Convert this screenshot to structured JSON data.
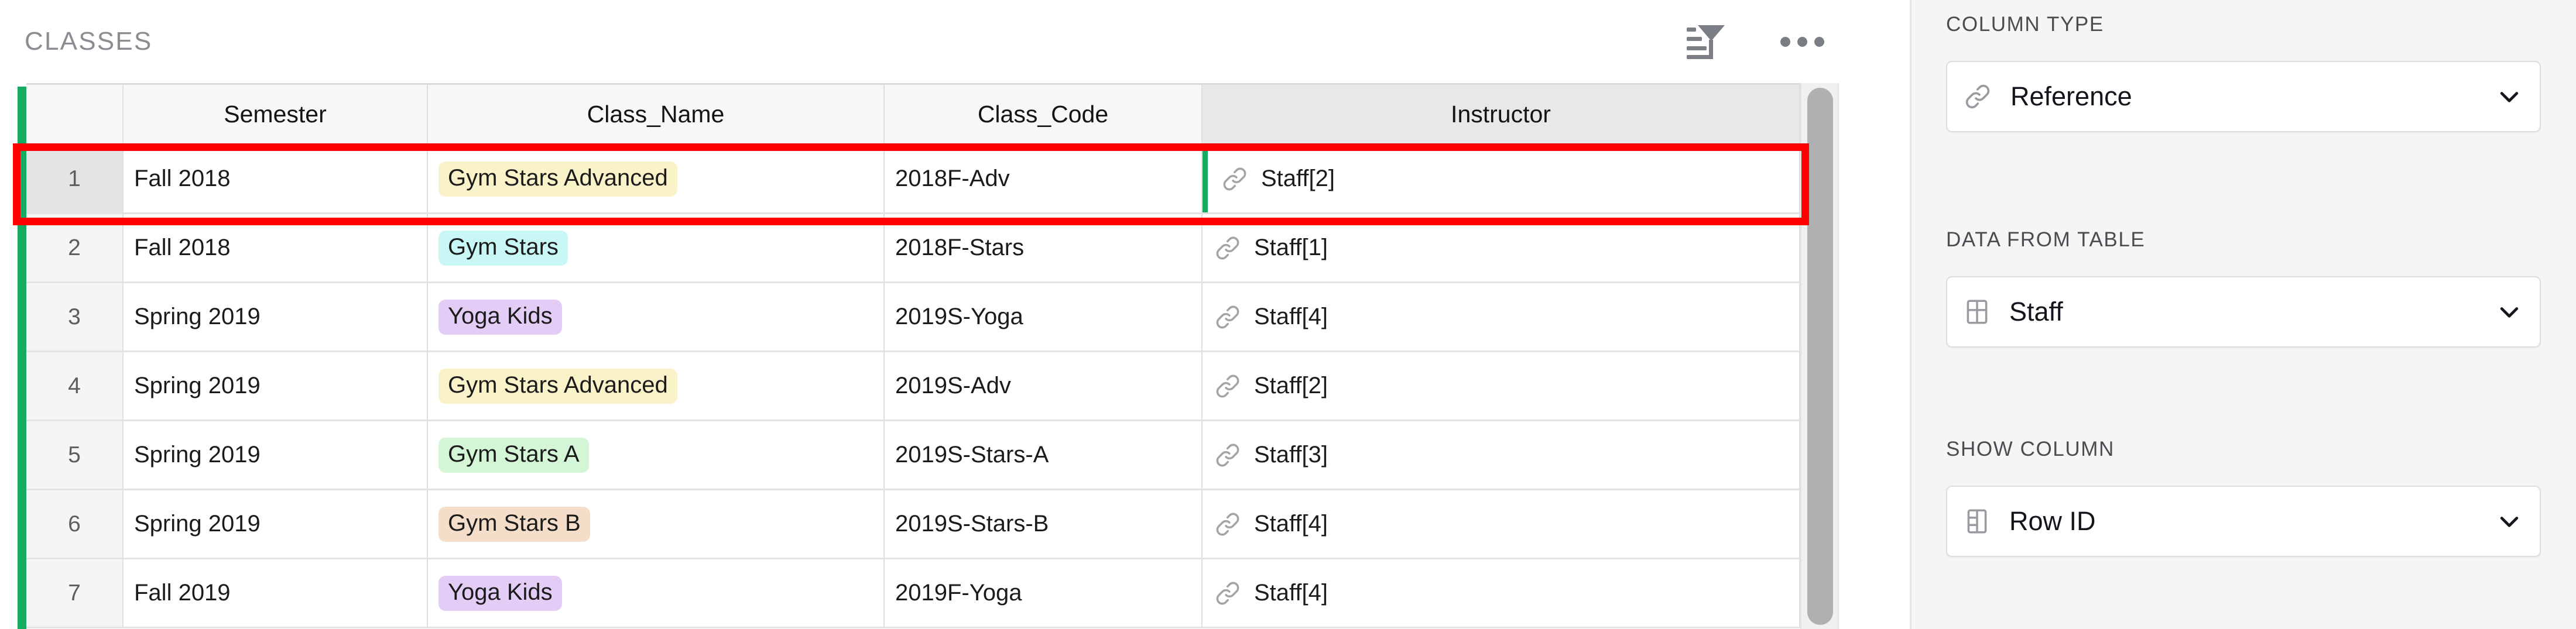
{
  "table_panel": {
    "title": "CLASSES",
    "toolbar": {
      "sort_filter_icon": "sort-filter-icon",
      "more_icon": "more-options-icon"
    },
    "columns": [
      {
        "key": "rownum",
        "label": ""
      },
      {
        "key": "semester",
        "label": "Semester"
      },
      {
        "key": "class_name",
        "label": "Class_Name"
      },
      {
        "key": "class_code",
        "label": "Class_Code"
      },
      {
        "key": "instructor",
        "label": "Instructor"
      }
    ],
    "rows": [
      {
        "rownum": "1",
        "semester": "Fall 2018",
        "class_name": "Gym Stars Advanced",
        "class_name_tag_color": "#faf2c8",
        "class_code": "2018F-Adv",
        "instructor": "Staff[2]",
        "instructor_icon": "link-icon",
        "selected": true
      },
      {
        "rownum": "2",
        "semester": "Fall 2018",
        "class_name": "Gym Stars",
        "class_name_tag_color": "#c9f7f5",
        "class_code": "2018F-Stars",
        "instructor": "Staff[1]",
        "instructor_icon": "link-icon",
        "selected": false
      },
      {
        "rownum": "3",
        "semester": "Spring 2019",
        "class_name": "Yoga Kids",
        "class_name_tag_color": "#e3cdf7",
        "class_code": "2019S-Yoga",
        "instructor": "Staff[4]",
        "instructor_icon": "link-icon",
        "selected": false
      },
      {
        "rownum": "4",
        "semester": "Spring 2019",
        "class_name": "Gym Stars Advanced",
        "class_name_tag_color": "#faf2c8",
        "class_code": "2019S-Adv",
        "instructor": "Staff[2]",
        "instructor_icon": "link-icon",
        "selected": false
      },
      {
        "rownum": "5",
        "semester": "Spring 2019",
        "class_name": "Gym Stars A",
        "class_name_tag_color": "#d4f5d6",
        "class_code": "2019S-Stars-A",
        "instructor": "Staff[3]",
        "instructor_icon": "link-icon",
        "selected": false
      },
      {
        "rownum": "6",
        "semester": "Spring 2019",
        "class_name": "Gym Stars B",
        "class_name_tag_color": "#f4ddc9",
        "class_code": "2019S-Stars-B",
        "instructor": "Staff[4]",
        "instructor_icon": "link-icon",
        "selected": false
      },
      {
        "rownum": "7",
        "semester": "Fall 2019",
        "class_name": "Yoga Kids",
        "class_name_tag_color": "#e3cdf7",
        "class_code": "2019F-Yoga",
        "instructor": "Staff[4]",
        "instructor_icon": "link-icon",
        "selected": false
      }
    ],
    "highlight": {
      "target_row": "1",
      "color": "#ff0000"
    },
    "selection_accent_color": "#16ab63"
  },
  "inspector": {
    "sections": [
      {
        "label": "COLUMN TYPE",
        "icon": "link-icon",
        "value": "Reference",
        "chevron": "chevron-down-icon"
      },
      {
        "label": "DATA FROM TABLE",
        "icon": "table-grid-icon",
        "value": "Staff",
        "chevron": "chevron-down-icon"
      },
      {
        "label": "SHOW COLUMN",
        "icon": "column-icon",
        "value": "Row ID",
        "chevron": "chevron-down-icon"
      }
    ]
  }
}
